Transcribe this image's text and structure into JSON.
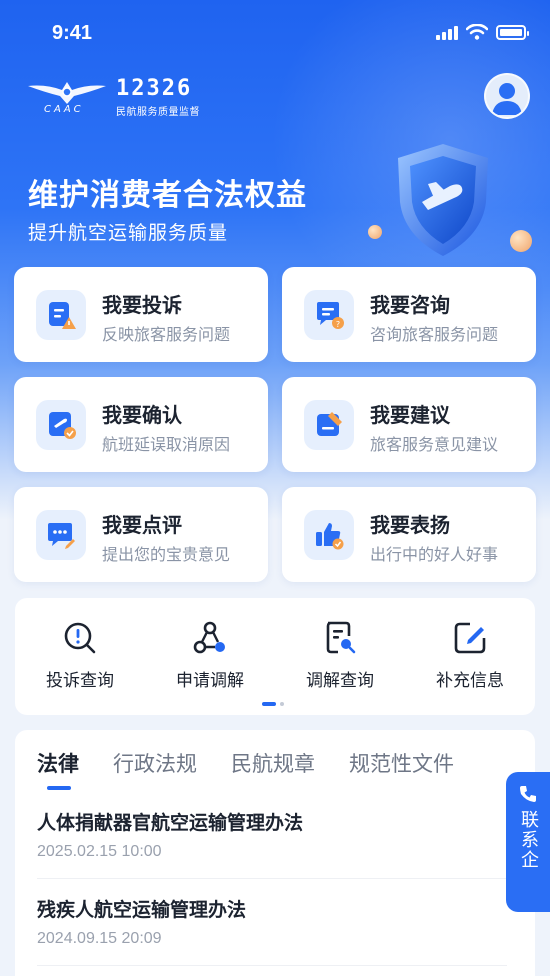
{
  "status_bar": {
    "time": "9:41"
  },
  "header": {
    "logo_acronym": "CAAC",
    "logo_number": "12326",
    "logo_subtitle": "民航服务质量监督",
    "avatar_icon": "user-avatar-icon"
  },
  "hero": {
    "slogan": "维护消费者合法权益",
    "subslogan": "提升航空运输服务质量"
  },
  "actions": [
    {
      "title": "我要投诉",
      "subtitle": "反映旅客服务问题",
      "icon": "complaint-icon"
    },
    {
      "title": "我要咨询",
      "subtitle": "咨询旅客服务问题",
      "icon": "consult-icon"
    },
    {
      "title": "我要确认",
      "subtitle": "航班延误取消原因",
      "icon": "flight-confirm-icon"
    },
    {
      "title": "我要建议",
      "subtitle": "旅客服务意见建议",
      "icon": "suggestion-icon"
    },
    {
      "title": "我要点评",
      "subtitle": "提出您的宝贵意见",
      "icon": "review-icon"
    },
    {
      "title": "我要表扬",
      "subtitle": "出行中的好人好事",
      "icon": "praise-icon"
    }
  ],
  "tools": [
    {
      "label": "投诉查询",
      "icon": "complaint-query-icon"
    },
    {
      "label": "申请调解",
      "icon": "mediation-apply-icon"
    },
    {
      "label": "调解查询",
      "icon": "mediation-query-icon"
    },
    {
      "label": "补充信息",
      "icon": "edit-info-icon"
    }
  ],
  "news": {
    "tabs": [
      "法律",
      "行政法规",
      "民航规章",
      "规范性文件"
    ],
    "active_tab": "法律",
    "items": [
      {
        "title": "人体捐献器官航空运输管理办法",
        "date": "2025.02.15 10:00"
      },
      {
        "title": "残疾人航空运输管理办法",
        "date": "2024.09.15 20:09"
      }
    ]
  },
  "contact": {
    "label": "联系企"
  },
  "colors": {
    "primary": "#2468f2",
    "accent_orange": "#f5a04a"
  }
}
